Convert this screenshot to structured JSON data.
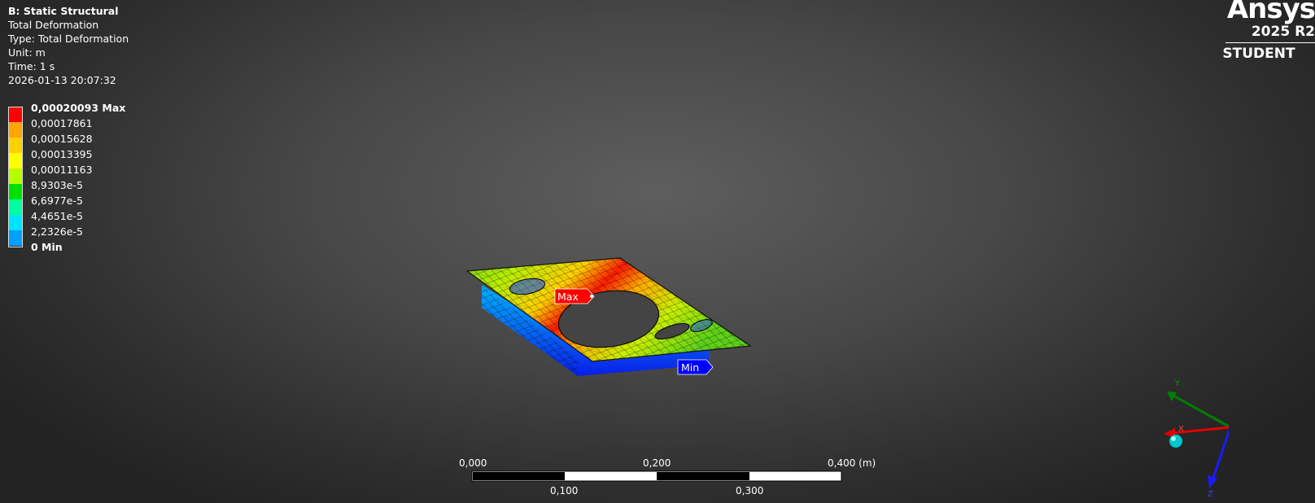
{
  "info": {
    "title": "B: Static Structural",
    "result": "Total Deformation",
    "type": "Type: Total Deformation",
    "unit": "Unit: m",
    "time": "Time: 1 s",
    "timestamp": "2026-01-13 20:07:32"
  },
  "legend": [
    {
      "label": "0,00020093 Max",
      "color": "#ff0000",
      "bold": true
    },
    {
      "label": "0,00017861",
      "color": "#ffa500",
      "bold": false
    },
    {
      "label": "0,00015628",
      "color": "#ffd000",
      "bold": false
    },
    {
      "label": "0,00013395",
      "color": "#ffff00",
      "bold": false
    },
    {
      "label": "0,00011163",
      "color": "#b6ff00",
      "bold": false
    },
    {
      "label": "8,9303e-5",
      "color": "#00e000",
      "bold": false
    },
    {
      "label": "6,6977e-5",
      "color": "#00ffa0",
      "bold": false
    },
    {
      "label": "4,4651e-5",
      "color": "#00e5ff",
      "bold": false
    },
    {
      "label": "2,2326e-5",
      "color": "#00a0ff",
      "bold": false
    },
    {
      "label": "0 Min",
      "color": "#0000ff",
      "bold": true
    }
  ],
  "brand": {
    "logo": "Ansys",
    "version": "2025 R2",
    "edition": "STUDENT"
  },
  "probes": {
    "max": "Max",
    "min": "Min"
  },
  "scale_bar": {
    "top_labels": [
      "0,000",
      "0,200",
      "0,400 (m)"
    ],
    "bottom_labels": [
      "0,100",
      "0,300"
    ]
  },
  "triad": {
    "x": "X",
    "y": "Y",
    "z": "Z"
  },
  "colors": {
    "background": "#474747",
    "max": "#ff0000",
    "min": "#0000ff",
    "x_axis": "#e00000",
    "y_axis": "#008000",
    "z_axis": "#1a1aff"
  }
}
